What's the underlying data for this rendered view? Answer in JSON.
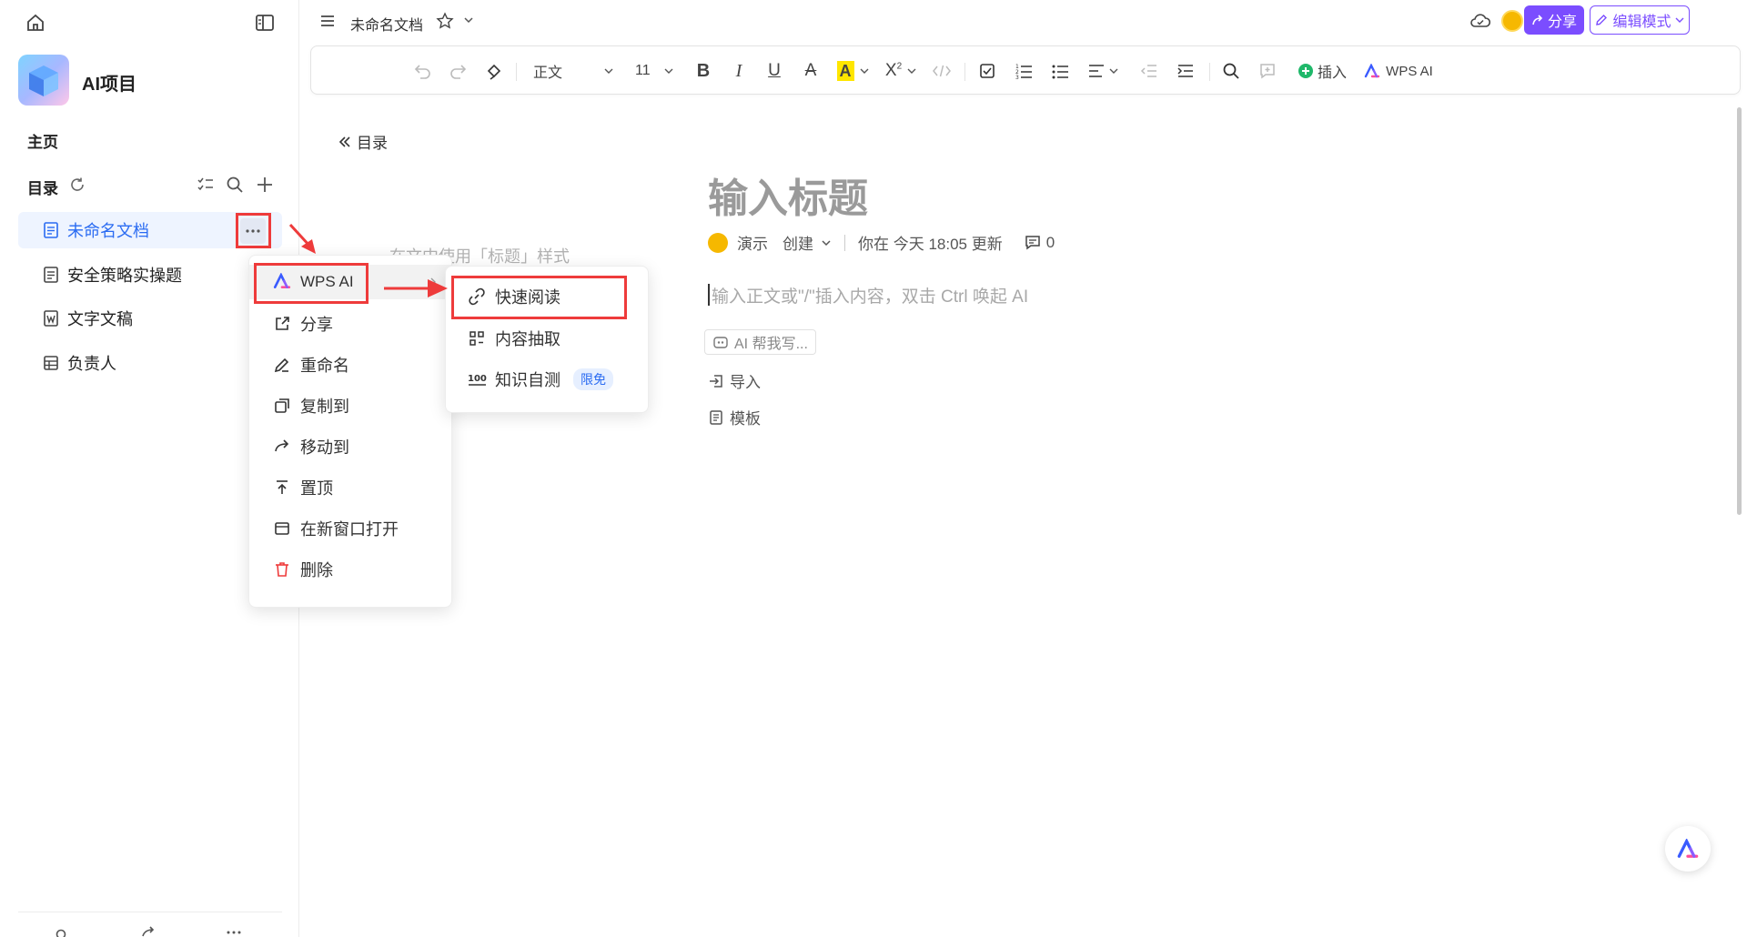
{
  "sidebar": {
    "project_name": "AI项目",
    "home_label": "主页",
    "toc_label": "目录",
    "tree": [
      {
        "label": "未命名文档",
        "icon": "doc-icon"
      },
      {
        "label": "安全策略实操题",
        "icon": "doc-icon"
      },
      {
        "label": "文字文稿",
        "icon": "word-icon"
      },
      {
        "label": "负责人",
        "icon": "table-icon"
      }
    ]
  },
  "topbar": {
    "doc_title": "未命名文档",
    "share_label": "分享",
    "edit_mode_label": "编辑模式"
  },
  "toolbar": {
    "paragraph_style": "正文",
    "font_size": "11",
    "insert_label": "插入",
    "wps_ai_label": "WPS AI"
  },
  "content": {
    "toc_back_label": "目录",
    "title_placeholder": "输入标题",
    "title_style_hint": "在文中使用「标题」样式",
    "author": "演示",
    "created_label": "创建",
    "updated_text": "你在 今天 18:05 更新",
    "comment_count": "0",
    "body_placeholder": "输入正文或\"/\"插入内容，双击 Ctrl 唤起 AI",
    "ai_help_label": "AI 帮我写...",
    "import_label": "导入",
    "template_label": "模板"
  },
  "context_menu": {
    "items": [
      {
        "label": "WPS AI"
      },
      {
        "label": "分享"
      },
      {
        "label": "重命名"
      },
      {
        "label": "复制到"
      },
      {
        "label": "移动到"
      },
      {
        "label": "置顶"
      },
      {
        "label": "在新窗口打开"
      },
      {
        "label": "删除"
      }
    ]
  },
  "ai_submenu": {
    "items": [
      {
        "label": "快速阅读"
      },
      {
        "label": "内容抽取"
      },
      {
        "label": "知识自测",
        "badge": "限免"
      }
    ]
  },
  "colors": {
    "accent": "#2a6bf2",
    "share_button": "#7b4dff",
    "highlight_red": "#ee3b3b"
  }
}
